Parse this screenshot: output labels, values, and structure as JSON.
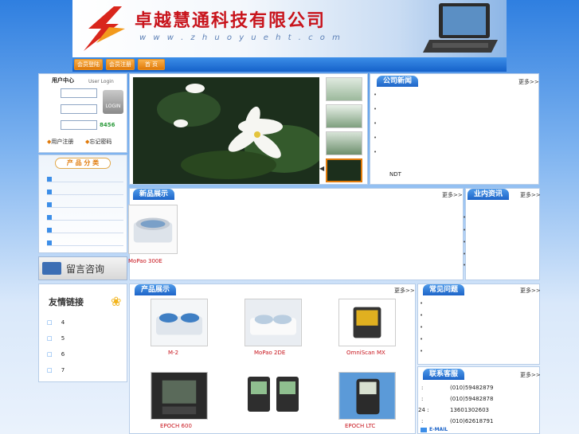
{
  "header": {
    "company": "卓越慧通科技有限公司",
    "website": "w w w . z h u o y u e h t . c o m",
    "nav": [
      "会员登陆",
      "会员注册",
      "首  页"
    ]
  },
  "login": {
    "title": "用户中心",
    "subtitle": "User Login",
    "button": "LOGIN",
    "captcha": "8456",
    "register": "用户注册",
    "forgot": "忘记密码"
  },
  "categories": {
    "title": "产 品 分 类"
  },
  "message": {
    "label": "留言咨询"
  },
  "links": {
    "title": "友情链接",
    "items": [
      "4",
      "5",
      "6",
      "7"
    ]
  },
  "news": {
    "title": "公司新闻",
    "more": "更多>>",
    "items": [
      "",
      "",
      "",
      "",
      "",
      "NDT"
    ]
  },
  "new_products": {
    "title": "新品展示",
    "more": "更多>>",
    "items": [
      {
        "name": "MoPao 300E"
      }
    ]
  },
  "industry": {
    "title": "业内资讯",
    "more": "更多>>"
  },
  "products": {
    "title": "产品展示",
    "more": "更多>>",
    "items": [
      {
        "name": "M-2"
      },
      {
        "name": "MoPao 2DE"
      },
      {
        "name": "OmniScan MX"
      },
      {
        "name": "EPOCH 600"
      },
      {
        "name": ""
      },
      {
        "name": "EPOCH LTC"
      }
    ]
  },
  "faq": {
    "title": "常见问题",
    "more": "更多>>"
  },
  "contact": {
    "title": "联系客服",
    "more": "更多>>",
    "rows": [
      {
        "k": ":",
        "v": "(010)59482879"
      },
      {
        "k": ":",
        "v": "(010)59482878"
      },
      {
        "k": "24  :",
        "v": "13601302603"
      },
      {
        "k": ":",
        "v": "(010)62618791"
      }
    ],
    "email": "E-MAIL"
  },
  "colors": {
    "accent": "#1d64c8",
    "brand_red": "#c8141c",
    "nav_orange": "#e07a0a"
  }
}
